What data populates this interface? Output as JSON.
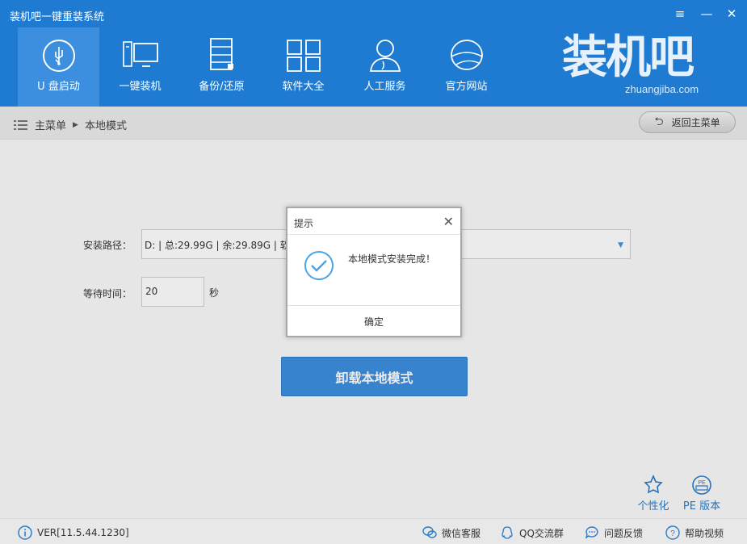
{
  "window": {
    "title": "装机吧一键重装系统",
    "controls": {
      "menu": "≡",
      "minimize": "—",
      "close": "✕"
    }
  },
  "nav": [
    {
      "label": "U 盘启动",
      "icon": "usb-icon",
      "active": true
    },
    {
      "label": "一键装机",
      "icon": "computer-icon",
      "active": false
    },
    {
      "label": "备份/还原",
      "icon": "backup-icon",
      "active": false
    },
    {
      "label": "软件大全",
      "icon": "apps-grid-icon",
      "active": false
    },
    {
      "label": "人工服务",
      "icon": "person-icon",
      "active": false
    },
    {
      "label": "官方网站",
      "icon": "globe-icon",
      "active": false
    }
  ],
  "brand": {
    "title": "装机吧",
    "url": "zhuangjiba.com"
  },
  "breadcrumb": {
    "root": "主菜单",
    "current": "本地模式"
  },
  "back_button": {
    "label": "返回主菜单"
  },
  "form": {
    "path_label": "安装路径：",
    "path_value": "D: | 总:29.99G | 余:29.89G | 软件",
    "wait_label": "等待时间：",
    "wait_value": "20",
    "wait_unit": "秒"
  },
  "uninstall_button": {
    "label": "卸载本地模式"
  },
  "tools": [
    {
      "label": "个性化",
      "icon": "personalize-icon"
    },
    {
      "label": "PE 版本",
      "icon": "pe-icon"
    }
  ],
  "dialog": {
    "title": "提示",
    "message": "本地模式安装完成！",
    "confirm": "确定",
    "close": "✕"
  },
  "status": {
    "version": "VER[11.5.44.1230]",
    "items": [
      {
        "label": "微信客服",
        "icon": "wechat-icon"
      },
      {
        "label": "QQ交流群",
        "icon": "qq-icon"
      },
      {
        "label": "问题反馈",
        "icon": "feedback-icon"
      },
      {
        "label": "帮助视频",
        "icon": "help-icon"
      }
    ]
  },
  "colors": {
    "header": "#1e7bd1",
    "accent": "#3d8fe0",
    "link": "#2a7cc9"
  }
}
